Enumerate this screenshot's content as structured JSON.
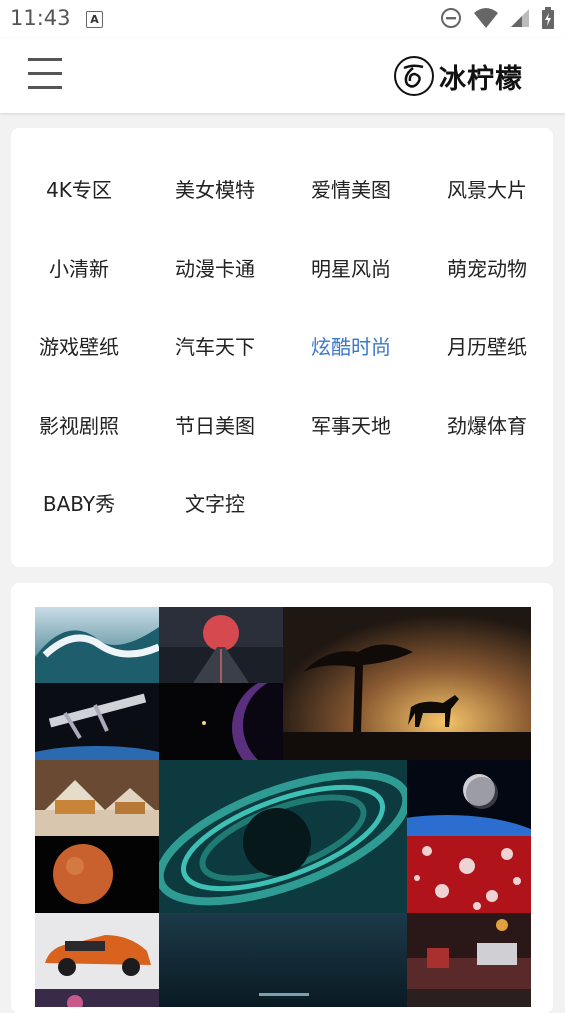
{
  "status_bar": {
    "time": "11:43",
    "badge": "A"
  },
  "header": {
    "logo_text": "冰柠檬"
  },
  "categories": [
    "4K专区",
    "美女模特",
    "爱情美图",
    "风景大片",
    "小清新",
    "动漫卡通",
    "明星风尚",
    "萌宠动物",
    "游戏壁纸",
    "汽车天下",
    "炫酷时尚",
    "月历壁纸",
    "影视剧照",
    "节日美图",
    "军事天地",
    "劲爆体育",
    "BABY秀",
    "文字控"
  ],
  "active_category": "炫酷时尚",
  "colors": {
    "accent": "#3a78c9",
    "text": "#222222",
    "background": "#f2f2f2"
  },
  "gallery": [
    {
      "name": "wave-thumbnail"
    },
    {
      "name": "red-planet-road-thumbnail"
    },
    {
      "name": "horse-sunset-thumbnail"
    },
    {
      "name": "space-station-thumbnail"
    },
    {
      "name": "purple-planet-thumbnail"
    },
    {
      "name": "winter-house-thumbnail"
    },
    {
      "name": "ringed-planet-thumbnail"
    },
    {
      "name": "earth-moon-thumbnail"
    },
    {
      "name": "mars-thumbnail"
    },
    {
      "name": "snowflake-thumbnail"
    },
    {
      "name": "orange-car-thumbnail"
    },
    {
      "name": "ocean-night-thumbnail"
    },
    {
      "name": "desk-lamp-thumbnail"
    }
  ]
}
